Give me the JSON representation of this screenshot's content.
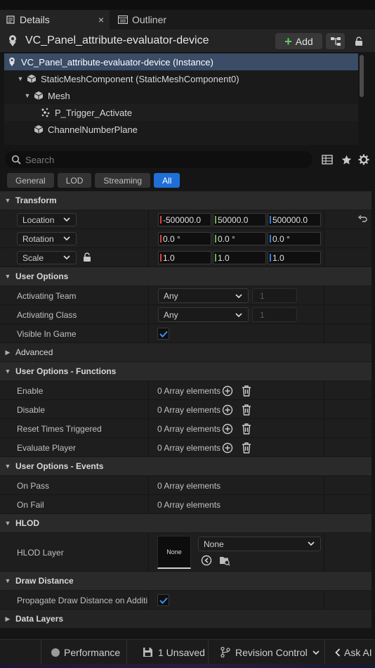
{
  "tabs": {
    "details": "Details",
    "outliner": "Outliner",
    "close": "×"
  },
  "actor": {
    "title": "VC_Panel_attribute-evaluator-device",
    "add_label": "Add"
  },
  "tree": {
    "items": [
      {
        "label": "VC_Panel_attribute-evaluator-device (Instance)"
      },
      {
        "label": "StaticMeshComponent (StaticMeshComponent0)"
      },
      {
        "label": "Mesh"
      },
      {
        "label": "P_Trigger_Activate"
      },
      {
        "label": "ChannelNumberPlane"
      }
    ]
  },
  "search": {
    "placeholder": "Search"
  },
  "filters": [
    "General",
    "LOD",
    "Streaming",
    "All"
  ],
  "transform": {
    "header": "Transform",
    "location_label": "Location",
    "rotation_label": "Rotation",
    "scale_label": "Scale",
    "location": [
      "-500000.0",
      "50000.0",
      "500000.0"
    ],
    "rotation": [
      "0.0 °",
      "0.0 °",
      "0.0 °"
    ],
    "scale": [
      "1.0",
      "1.0",
      "1.0"
    ]
  },
  "user_options": {
    "header": "User Options",
    "team_label": "Activating Team",
    "team_value": "Any",
    "team_num": "1",
    "class_label": "Activating Class",
    "class_value": "Any",
    "class_num": "1",
    "visible_label": "Visible In Game",
    "visible_checked": true
  },
  "advanced": {
    "header": "Advanced"
  },
  "functions": {
    "header": "User Options - Functions",
    "rows": [
      {
        "label": "Enable",
        "value": "0 Array elements"
      },
      {
        "label": "Disable",
        "value": "0 Array elements"
      },
      {
        "label": "Reset Times Triggered",
        "value": "0 Array elements"
      },
      {
        "label": "Evaluate Player",
        "value": "0 Array elements"
      }
    ]
  },
  "events": {
    "header": "User Options - Events",
    "rows": [
      {
        "label": "On Pass",
        "value": "0 Array elements"
      },
      {
        "label": "On Fail",
        "value": "0 Array elements"
      }
    ]
  },
  "hlod": {
    "header": "HLOD",
    "layer_label": "HLOD Layer",
    "thumb_label": "None",
    "dropdown_value": "None"
  },
  "draw_distance": {
    "header": "Draw Distance",
    "propagate_label": "Propagate Draw Distance on Additi...",
    "propagate_checked": true
  },
  "data_layers": {
    "header": "Data Layers"
  },
  "statusbar": {
    "performance": "Performance",
    "unsaved": "1 Unsaved",
    "revision": "Revision Control",
    "ask_ai": "Ask AI"
  },
  "colors": {
    "accent": "#1f6fd6",
    "selection": "#3a4c66",
    "x_axis": "#d8473c",
    "y_axis": "#6ab04c",
    "z_axis": "#3a7ed8",
    "add_plus": "#5fd05f"
  }
}
